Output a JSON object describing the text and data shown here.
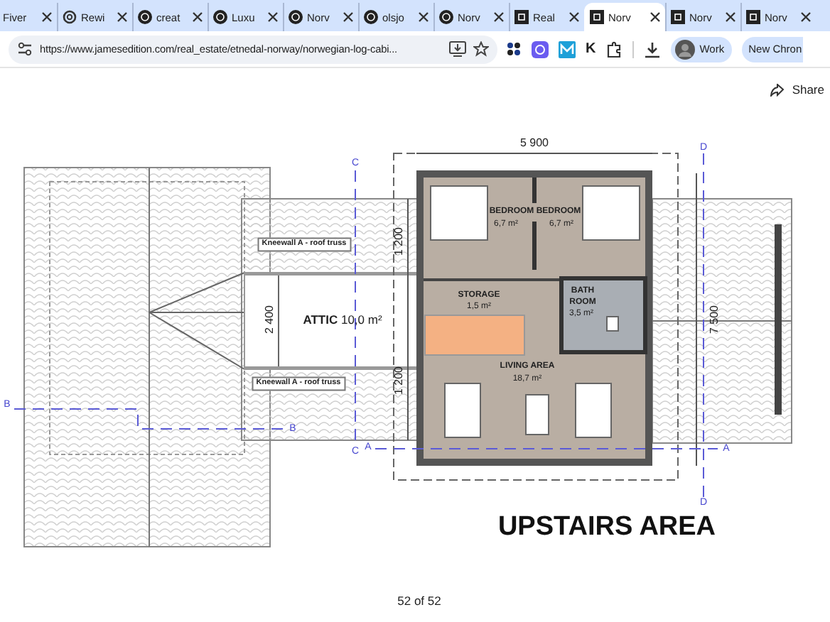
{
  "tabs": [
    {
      "label": "Fiver",
      "selected": false
    },
    {
      "label": "Rewi",
      "selected": false
    },
    {
      "label": "creat",
      "selected": false
    },
    {
      "label": "Luxu",
      "selected": false
    },
    {
      "label": "Norv",
      "selected": false
    },
    {
      "label": "olsjo",
      "selected": false
    },
    {
      "label": "Norv",
      "selected": false
    },
    {
      "label": "Real",
      "selected": false
    },
    {
      "label": "Norv",
      "selected": true
    },
    {
      "label": "Norv",
      "selected": false
    },
    {
      "label": "Norv",
      "selected": false
    }
  ],
  "toolbar": {
    "url": "https://www.jamesedition.com/real_estate/etnedal-norway/norwegian-log-cabi...",
    "extension_letter": "K",
    "profile": "Work",
    "new_chrome": "New Chron"
  },
  "share": "Share",
  "plan": {
    "labels": [
      {
        "text": "5 900",
        "kind": "dim"
      },
      {
        "text": "BEDROOM",
        "kind": "room-name"
      },
      {
        "text": "6,7 m²",
        "kind": "room-area"
      },
      {
        "text": "BEDROOM",
        "kind": "room-name"
      },
      {
        "text": "6,7 m²",
        "kind": "room-area"
      },
      {
        "text": "STORAGE",
        "kind": "room-name"
      },
      {
        "text": "1,5 m²",
        "kind": "room-area"
      },
      {
        "text": "BATH",
        "kind": "room-name"
      },
      {
        "text": "ROOM",
        "kind": "room-name"
      },
      {
        "text": "3,5 m²",
        "kind": "room-area"
      },
      {
        "text": "**ATTIC** 10,0 m²",
        "kind": "attic"
      },
      {
        "text": "2 400",
        "kind": "vdim"
      },
      {
        "text": "1 200",
        "kind": "vdim"
      },
      {
        "text": "1 200",
        "kind": "vdim"
      },
      {
        "text": "7 500",
        "kind": "vdim"
      },
      {
        "text": "LIVING AREA",
        "kind": "room-name"
      },
      {
        "text": "18,7 m²",
        "kind": "room-area"
      },
      {
        "text": "Kneewall A - roof truss",
        "kind": "note"
      },
      {
        "text": "Kneewall A - roof truss",
        "kind": "note"
      },
      {
        "text": "UPSTAIRS AREA",
        "kind": "title"
      },
      {
        "text": "C",
        "kind": "marker"
      },
      {
        "text": "C",
        "kind": "marker"
      },
      {
        "text": "D",
        "kind": "marker"
      },
      {
        "text": "D",
        "kind": "marker"
      },
      {
        "text": "B",
        "kind": "marker"
      },
      {
        "text": "B",
        "kind": "marker"
      },
      {
        "text": "A",
        "kind": "marker"
      },
      {
        "text": "A",
        "kind": "marker"
      }
    ]
  },
  "page_counter": "52 of 52"
}
